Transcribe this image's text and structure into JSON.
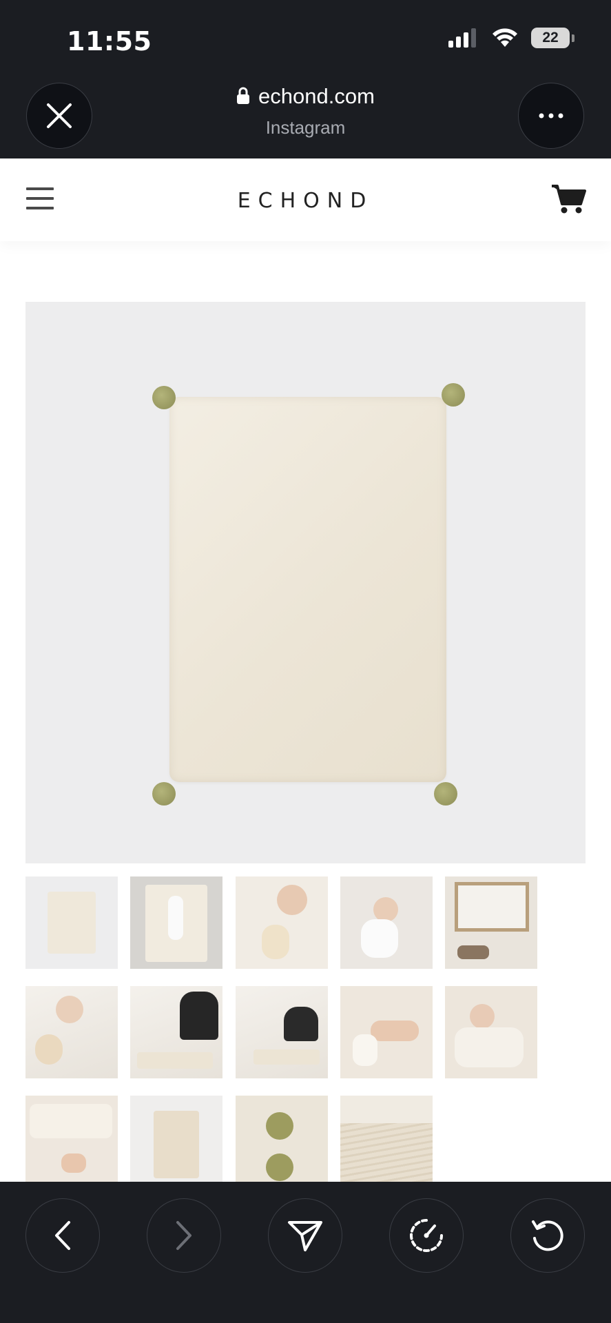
{
  "status_bar": {
    "time": "11:55",
    "battery": "22"
  },
  "browser": {
    "domain": "echond.com",
    "source": "Instagram"
  },
  "site": {
    "logo": "ECHOND"
  },
  "icons": [
    "close-icon",
    "lock-icon",
    "more-icon",
    "menu-icon",
    "cart-icon",
    "back-icon",
    "forward-icon",
    "share-icon",
    "speed-icon",
    "reload-icon"
  ],
  "colors": {
    "chrome": "#1b1d22",
    "hero_bg": "#ededee",
    "pompom": "#9a9a62"
  }
}
